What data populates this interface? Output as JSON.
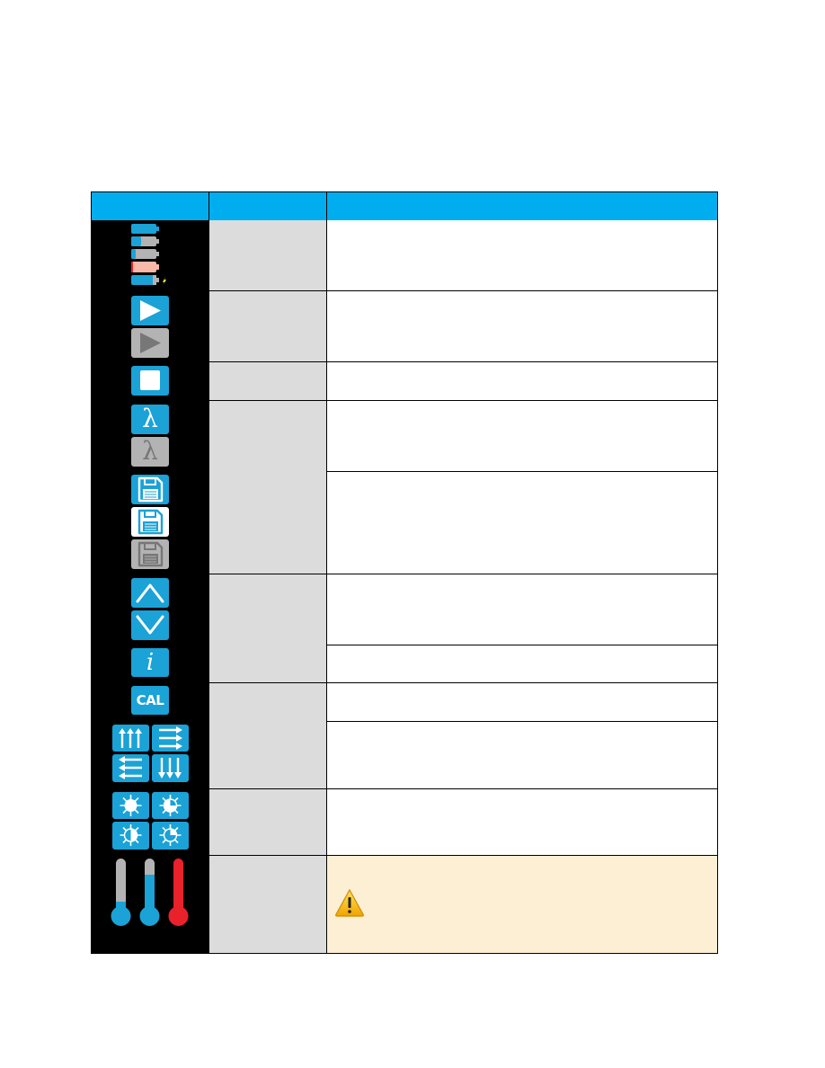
{
  "table": {
    "header": {
      "columns": [
        "",
        "",
        ""
      ],
      "color": "#00aeef"
    },
    "rows": [
      {
        "icons": [
          "battery-full-icon",
          "battery-half-icon",
          "battery-low-icon",
          "battery-empty-icon",
          "battery-charging-icon"
        ],
        "name": "",
        "descriptions": [
          ""
        ]
      },
      {
        "icons": [
          "play-active-icon",
          "play-disabled-icon"
        ],
        "name": "",
        "descriptions": [
          ""
        ]
      },
      {
        "icons": [
          "stop-icon"
        ],
        "name": "",
        "descriptions": [
          ""
        ]
      },
      {
        "icons": [
          "lambda-active-icon",
          "lambda-disabled-icon",
          "save-active-icon",
          "save-selected-icon",
          "save-disabled-icon"
        ],
        "name": "",
        "descriptions": [
          "",
          ""
        ]
      },
      {
        "icons": [
          "arrow-up-icon",
          "arrow-down-icon",
          "info-icon"
        ],
        "name": "",
        "descriptions": [
          "",
          ""
        ]
      },
      {
        "icons": [
          "cal-icon",
          "rotate-up-icon",
          "rotate-right-icon",
          "rotate-left-icon",
          "rotate-down-icon"
        ],
        "name": "",
        "descriptions": [
          "",
          ""
        ]
      },
      {
        "icons": [
          "brightness-full-icon",
          "brightness-75-icon",
          "brightness-50-icon",
          "brightness-25-icon"
        ],
        "name": "",
        "descriptions": [
          ""
        ]
      },
      {
        "icons": [
          "thermometer-low-icon",
          "thermometer-mid-icon",
          "thermometer-hot-icon"
        ],
        "name": "",
        "descriptions": [
          ""
        ],
        "warning": true
      }
    ],
    "icon_labels": {
      "lambda": "λ",
      "info": "i",
      "cal": "CAL",
      "warning": "!"
    },
    "colors": {
      "icon_blue": "#1ba2d6",
      "icon_grey": "#b3b3b3",
      "battery_empty": "#f8b9a8",
      "thermometer_hot": "#e8212b",
      "warning_bg": "#fcefd4",
      "name_cell_bg": "#dcdcdc"
    }
  }
}
